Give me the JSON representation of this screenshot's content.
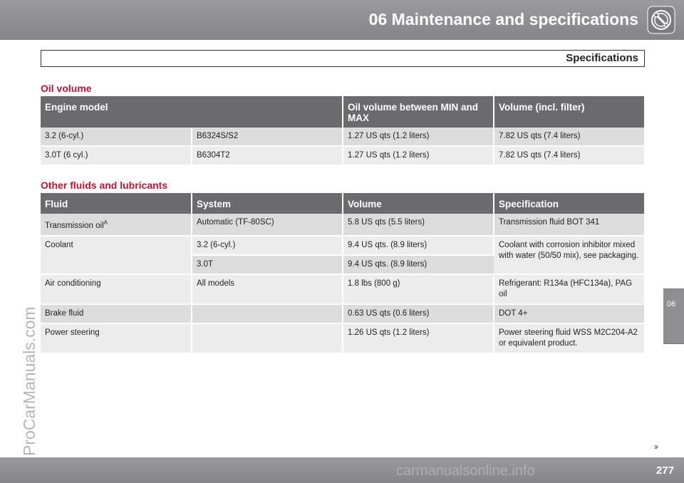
{
  "header": {
    "chapter_title": "06 Maintenance and specifications",
    "section_title": "Specifications"
  },
  "icons": {
    "chapter": "wrench-tool-icon"
  },
  "side_tab": {
    "label": "06"
  },
  "watermark": {
    "text": "ProCarManuals.com"
  },
  "oil_volume": {
    "heading": "Oil volume",
    "headers": {
      "engine_model": "Engine model",
      "between": "Oil volume between MIN and MAX",
      "total": "Volume (incl. filter)"
    },
    "rows": [
      {
        "engine": "3.2 (6-cyl.)",
        "code": "B6324S/S2",
        "between": "1.27 US qts (1.2 liters)",
        "total": "7.82 US qts (7.4 liters)"
      },
      {
        "engine": "3.0T (6 cyl.)",
        "code": "B6304T2",
        "between": "1.27 US qts (1.2 liters)",
        "total": "7.82 US qts (7.4 liters)"
      }
    ]
  },
  "fluids": {
    "heading": "Other fluids and lubricants",
    "headers": {
      "fluid": "Fluid",
      "system": "System",
      "volume": "Volume",
      "spec": "Specification"
    },
    "transmission": {
      "fluid": "Transmission oil",
      "footnote": "A",
      "system": "Automatic (TF-80SC)",
      "volume": "5.8 US qts (5.5 liters)",
      "spec": "Transmission fluid BOT 341"
    },
    "coolant": {
      "fluid": "Coolant",
      "system_1": "3.2 (6-cyl.)",
      "volume_1": "9.4 US qts. (8.9 liters)",
      "system_2": "3.0T",
      "volume_2": "9.4 US qts. (8.9 liters)",
      "spec": "Coolant with corrosion inhibitor mixed with water (50/50 mix), see packaging."
    },
    "air_conditioning": {
      "fluid": "Air conditioning",
      "system": "All models",
      "volume": "1.8 lbs (800 g)",
      "spec": "Refrigerant: R134a (HFC134a), PAG oil"
    },
    "brake": {
      "fluid": "Brake fluid",
      "system": "",
      "volume": "0.63 US qts (0.6 liters)",
      "spec": "DOT 4+"
    },
    "power_steering": {
      "fluid": "Power steering",
      "system": "",
      "volume": "1.26 US qts (1.2 liters)",
      "spec": "Power steering fluid WSS M2C204-A2 or equivalent product."
    }
  },
  "footer": {
    "next_arrows": "››",
    "page_number": "277",
    "watermark": "carmanualsonline.info"
  }
}
